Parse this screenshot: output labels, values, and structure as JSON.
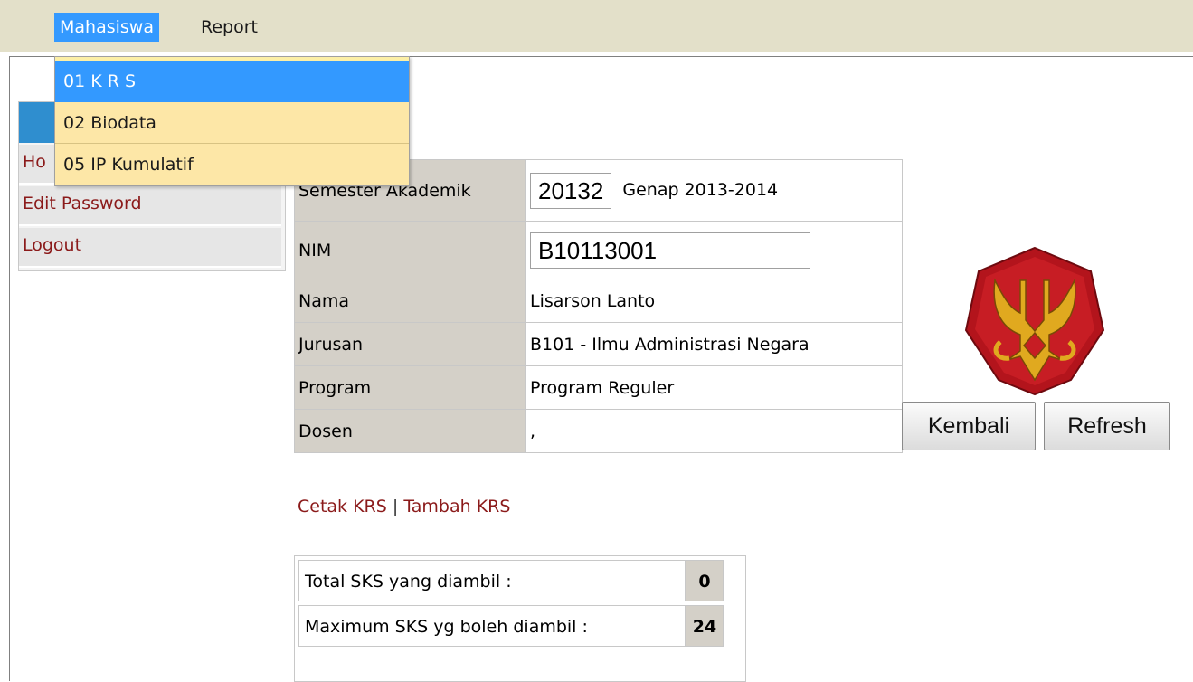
{
  "menubar": {
    "items": [
      {
        "label": "Mahasiswa"
      },
      {
        "label": "Report"
      }
    ]
  },
  "dropdown": {
    "items": [
      {
        "label": "01 K R S"
      },
      {
        "label": "02 Biodata"
      },
      {
        "label": "05 IP Kumulatif"
      }
    ]
  },
  "sidebar": {
    "items": [
      {
        "label": "Ho"
      },
      {
        "label": "Edit Password"
      },
      {
        "label": "Logout"
      }
    ]
  },
  "info": {
    "semester": {
      "label": "Semester Akademik",
      "code": "20132",
      "desc": "Genap 2013-2014"
    },
    "nim": {
      "label": "NIM",
      "value": "B10113001"
    },
    "nama": {
      "label": "Nama",
      "value": "Lisarson Lanto"
    },
    "jurusan": {
      "label": "Jurusan",
      "value": "B101 - Ilmu Administrasi Negara"
    },
    "program": {
      "label": "Program",
      "value": "Program Reguler"
    },
    "dosen": {
      "label": "Dosen",
      "value": ","
    }
  },
  "buttons": {
    "kembali": "Kembali",
    "refresh": "Refresh"
  },
  "links": {
    "cetak": "Cetak KRS",
    "separator": " | ",
    "tambah": "Tambah KRS"
  },
  "sks": {
    "total_label": "Total SKS yang diambil :",
    "total_value": "0",
    "max_label": "Maximum SKS yg boleh diambil :",
    "max_value": "24"
  },
  "colors": {
    "accent": "#3399ff",
    "menubar": "#e3e0c9",
    "link": "#8b1a1a",
    "logo_red": "#b3141c",
    "logo_gold": "#e0a91f"
  },
  "icons": {
    "logo": "university-emblem"
  }
}
